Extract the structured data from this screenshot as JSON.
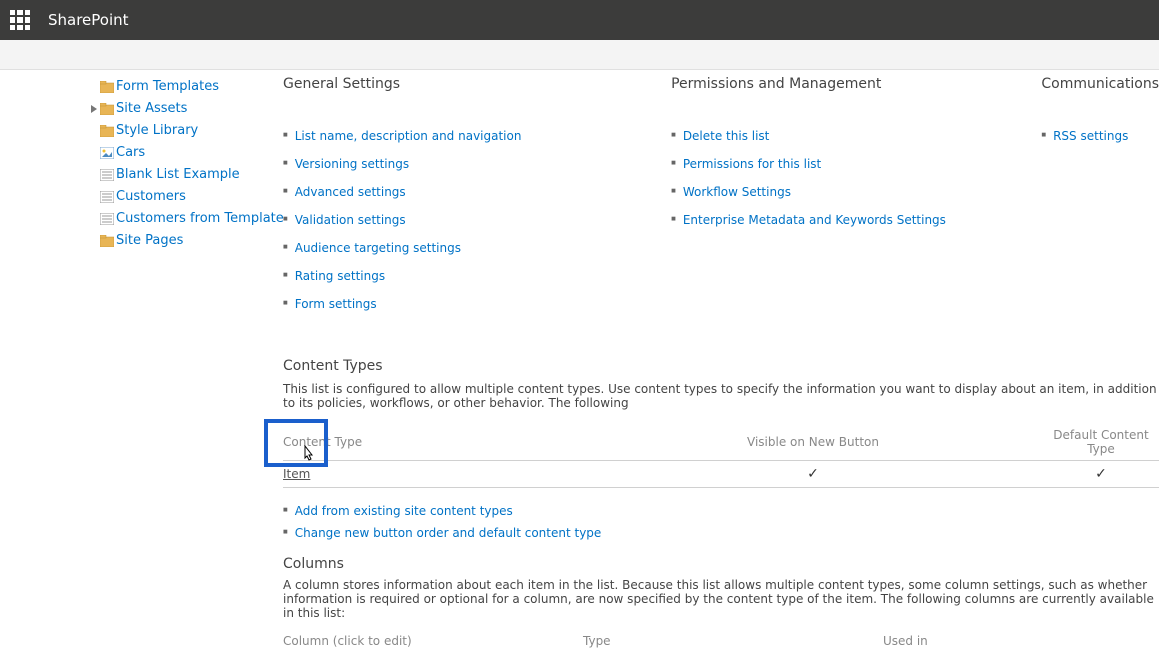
{
  "app": {
    "name": "SharePoint"
  },
  "sidebar": {
    "items": [
      {
        "label": "Form Templates",
        "icon": "folder"
      },
      {
        "label": "Site Assets",
        "icon": "folder",
        "expandable": true
      },
      {
        "label": "Style Library",
        "icon": "folder"
      },
      {
        "label": "Cars",
        "icon": "image-list"
      },
      {
        "label": "Blank List Example",
        "icon": "list"
      },
      {
        "label": "Customers",
        "icon": "list"
      },
      {
        "label": "Customers from Template",
        "icon": "list"
      },
      {
        "label": "Site Pages",
        "icon": "folder"
      }
    ]
  },
  "sections": {
    "general": {
      "title": "General Settings",
      "links": [
        "List name, description and navigation",
        "Versioning settings",
        "Advanced settings",
        "Validation settings",
        "Audience targeting settings",
        "Rating settings",
        "Form settings"
      ]
    },
    "permissions": {
      "title": "Permissions and Management",
      "links": [
        "Delete this list",
        "Permissions for this list",
        "Workflow Settings",
        "Enterprise Metadata and Keywords Settings"
      ]
    },
    "communications": {
      "title": "Communications",
      "links": [
        "RSS settings"
      ]
    }
  },
  "content_types": {
    "title": "Content Types",
    "description": "This list is configured to allow multiple content types. Use content types to specify the information you want to display about an item, in addition to its policies, workflows, or other behavior. The following",
    "headers": {
      "name": "Content Type",
      "visible": "Visible on New Button",
      "default": "Default Content Type"
    },
    "rows": [
      {
        "name": "Item",
        "visible": true,
        "default": true
      }
    ],
    "actions": [
      "Add from existing site content types",
      "Change new button order and default content type"
    ]
  },
  "columns": {
    "title": "Columns",
    "description": "A column stores information about each item in the list. Because this list allows multiple content types, some column settings, such as whether information is required or optional for a column, are now specified by the content type of the item. The following columns are currently available in this list:",
    "headers": {
      "name": "Column (click to edit)",
      "type": "Type",
      "used": "Used in"
    }
  }
}
